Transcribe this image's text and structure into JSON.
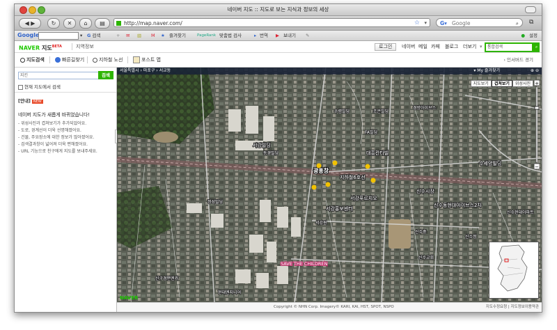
{
  "window": {
    "title": "네이버 지도 :: 지도로 보는 지식과 정보의 세상"
  },
  "toolbar": {
    "url": "http://map.naver.com/",
    "search_placeholder": "Google"
  },
  "google_toolbar": {
    "logo": "Google",
    "items": [
      "검색",
      "즐겨찾기",
      "PageRank",
      "맞춤법 검사",
      "번역",
      "보내기"
    ],
    "settings": "설정"
  },
  "naver_header": {
    "logo_naver": "NAVER",
    "logo_map": "지도",
    "logo_beta": "BETA",
    "sub": "지역정보",
    "login": "로그인",
    "links": [
      "네이버",
      "메일",
      "카페",
      "블로그",
      "더보기"
    ],
    "search_placeholder": "통합검색"
  },
  "service_tabs": {
    "items": [
      "지도검색",
      "빠른길찾기",
      "지하철 노선",
      "포스트 맵"
    ],
    "help": "› 인서버드 경기"
  },
  "sidebar": {
    "search_placeholder": "지킨",
    "search_button": "검색",
    "checkbox_label": "현재 지도에서 검색",
    "notice_label": "[안내]",
    "notice_badge": "NEW",
    "notice_head": "네이버 지도가 새롭게 바뀌었습니다!",
    "notice_items": [
      "- 위성사진과 겹쳐보기가 추가되었어요.",
      "- 도로, 경계선이 더욱 선명해졌어요.",
      "- 건물, 주요장소에 대한 정보가 많아졌어요.",
      "- 검색결과창이 넓어져 더욱 편해졌어요.",
      "- URL 기능으로 친구에게 지도를 보내주세요."
    ]
  },
  "map": {
    "breadcrumb": "서울특별시 › 마포구 › 서교동",
    "my_location": "▾ My 즐겨찾기",
    "map_types": [
      "지도보기",
      "겹쳐보기",
      "위성사진"
    ],
    "selected_map_type": "겹쳐보기",
    "logo": "NAVER",
    "labels": {
      "subway_line": "지하철6호선",
      "station": "광흥창",
      "seogang_bldg": "서강빌딩",
      "sinsu_market": "신수시장",
      "daeheung_central": "대흥칸타빌",
      "seogang_prugio": "서강푸르지오",
      "sinsu_church": "신수교회",
      "sinsu_middle": "신수중",
      "sinsu_apt": "신수현대아파트",
      "seogang_pr_center": "서강홍보센터",
      "seogang_hall": "서강원",
      "fa_bldg": "FA빌딩",
      "joeun_bldg": "조은빌딩",
      "sukyeong_bldg": "수렴빌딩",
      "donggyeong_bldg": "동경빌딩",
      "save_children": "SAVE THE CHILDREN",
      "sugyeong_ap": "수세양빌딩",
      "gyeongbang": "경방아이브스",
      "sinsu_ap2": "신수동현대아이브스2차",
      "sinsu_hyundai": "신구경편엔카",
      "sinsu_jeong": "신수정",
      "jeongseong": "정성빌딩",
      "hanjeon": "현대엔지니어"
    }
  },
  "footer": {
    "copyright": "Copyright © NHN Corp. Imagery© KARI, KAI, HST, SPOT, NSPO",
    "links": "지도수정요청 | 지도정보이용약관"
  }
}
